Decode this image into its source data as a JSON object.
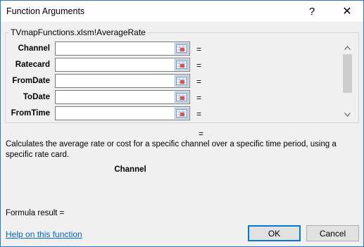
{
  "window": {
    "title": "Function Arguments",
    "help_glyph": "?",
    "close_glyph": "✕"
  },
  "function": {
    "group_label": "TVmapFunctions.xlsm!AverageRate",
    "arguments": [
      {
        "label": "Channel",
        "value": "",
        "equals": "="
      },
      {
        "label": "Ratecard",
        "value": "",
        "equals": "="
      },
      {
        "label": "FromDate",
        "value": "",
        "equals": "="
      },
      {
        "label": "ToDate",
        "value": "",
        "equals": "="
      },
      {
        "label": "FromTime",
        "value": "",
        "equals": "="
      }
    ],
    "result_equals": "=",
    "description": "Calculates the average rate or cost for a specific channel over a specific time period, using a specific rate card.",
    "current_argument": "Channel"
  },
  "footer": {
    "formula_result_label": "Formula result =",
    "formula_result_value": "",
    "help_link": "Help on this function",
    "ok_label": "OK",
    "cancel_label": "Cancel"
  },
  "icons": {
    "ref_button": "range-select-icon",
    "scroll_up": "chevron-up-icon",
    "scroll_down": "chevron-down-icon"
  }
}
